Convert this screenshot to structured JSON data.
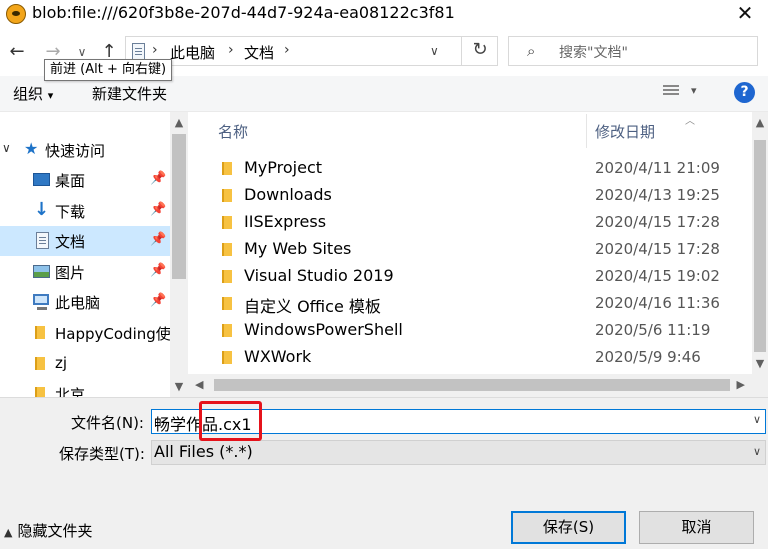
{
  "window": {
    "title": "blob:file:///620f3b8e-207d-44d7-924a-ea08122c3f81",
    "close": "✕"
  },
  "nav": {
    "back": "←",
    "forward": "→",
    "recent": "∨",
    "up": "↑",
    "tooltip": "前进 (Alt + 向右键)",
    "breadcrumb": [
      "此电脑",
      "文档"
    ],
    "refresh": "↻",
    "search_placeholder": "搜索\"文档\""
  },
  "toolbar": {
    "organize": "组织",
    "new_folder": "新建文件夹",
    "help": "?"
  },
  "sidebar": {
    "items": [
      {
        "label": "快速访问",
        "icon": "star-icon"
      },
      {
        "label": "桌面",
        "icon": "desktop-icon",
        "pinned": true
      },
      {
        "label": "下载",
        "icon": "download-icon",
        "pinned": true
      },
      {
        "label": "文档",
        "icon": "document-icon",
        "pinned": true,
        "selected": true
      },
      {
        "label": "图片",
        "icon": "picture-icon",
        "pinned": true
      },
      {
        "label": "此电脑",
        "icon": "computer-icon",
        "pinned": true
      },
      {
        "label": "HappyCoding使",
        "icon": "folder-icon"
      },
      {
        "label": "zj",
        "icon": "folder-icon"
      },
      {
        "label": "北京",
        "icon": "folder-icon"
      }
    ]
  },
  "columns": {
    "name": "名称",
    "date": "修改日期"
  },
  "files": [
    {
      "name": "MyProject",
      "date": "2020/4/11 21:09"
    },
    {
      "name": "Downloads",
      "date": "2020/4/13 19:25"
    },
    {
      "name": "IISExpress",
      "date": "2020/4/15 17:28"
    },
    {
      "name": "My Web Sites",
      "date": "2020/4/15 17:28"
    },
    {
      "name": "Visual Studio 2019",
      "date": "2020/4/15 19:02"
    },
    {
      "name": "自定义 Office 模板",
      "date": "2020/4/16 11:36"
    },
    {
      "name": "WindowsPowerShell",
      "date": "2020/5/6 11:19"
    },
    {
      "name": "WXWork",
      "date": "2020/5/9 9:46"
    }
  ],
  "form": {
    "filename_label": "文件名(N):",
    "filename_value": "畅学作品.cx1",
    "filetype_label": "保存类型(T):",
    "filetype_value": "All Files (*.*)"
  },
  "footer": {
    "hide_folders": "隐藏文件夹",
    "save": "保存(S)",
    "cancel": "取消"
  },
  "colors": {
    "accent": "#0078d7",
    "selection": "#cce8ff",
    "highlight_box": "#e5131b"
  }
}
